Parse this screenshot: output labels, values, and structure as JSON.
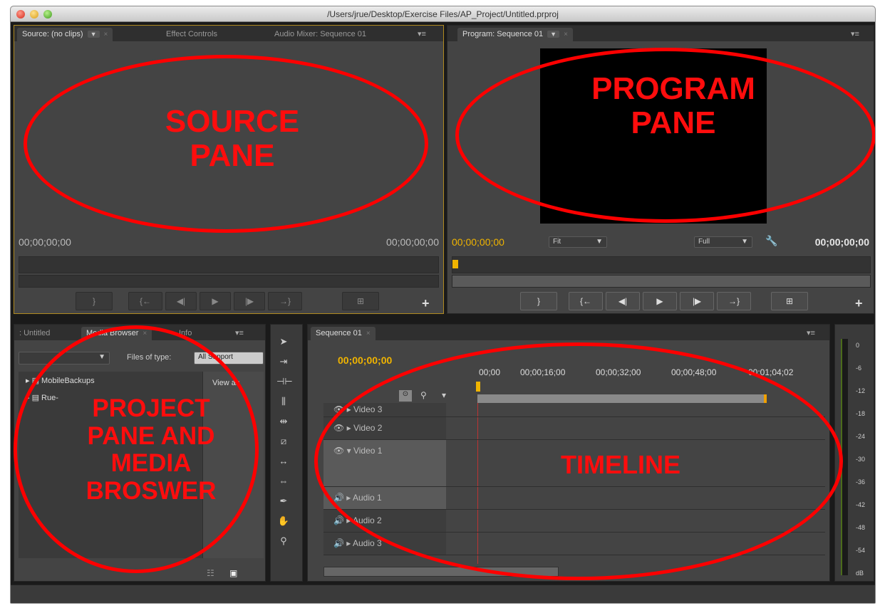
{
  "window": {
    "title": "/Users/jrue/Desktop/Exercise Files/AP_Project/Untitled.prproj"
  },
  "source_panel": {
    "tabs": [
      "Source: (no clips)",
      "Effect Controls",
      "Audio Mixer: Sequence 01"
    ],
    "timecode_left": "00;00;00;00",
    "timecode_right": "00;00;00;00",
    "annotation": "SOURCE PANE"
  },
  "program_panel": {
    "tab": "Program: Sequence 01",
    "timecode_left": "00;00;00;00",
    "timecode_right": "00;00;00;00",
    "fit": "Fit",
    "quality": "Full",
    "annotation": "PROGRAM PANE"
  },
  "project_panel": {
    "tabs": [
      ": Untitled",
      "Media Browser",
      "Info"
    ],
    "files_of_type_label": "Files of type:",
    "files_of_type_value": "All Support",
    "view_as": "View as",
    "items": [
      "MobileBackups",
      "Rue-"
    ],
    "annotation": "PROJECT PANE AND MEDIA BROSWER"
  },
  "timeline": {
    "tab": "Sequence 01",
    "timecode": "00;00;00;00",
    "ruler": [
      "00;00",
      "00;00;16;00",
      "00;00;32;00",
      "00;00;48;00",
      "00;01;04;02"
    ],
    "tracks": [
      "Video 3",
      "Video 2",
      "Video 1",
      "Audio 1",
      "Audio 2",
      "Audio 3"
    ],
    "annotation": "TIMELINE"
  },
  "meter": {
    "labels": [
      "0",
      "-6",
      "-12",
      "-18",
      "-24",
      "-30",
      "-36",
      "-42",
      "-48",
      "-54",
      "dB"
    ]
  },
  "icons": {
    "tools": [
      "selection-tool-icon",
      "track-select-tool-icon",
      "ripple-edit-tool-icon",
      "rolling-edit-tool-icon",
      "rate-stretch-tool-icon",
      "razor-tool-icon",
      "slip-tool-icon",
      "slide-tool-icon",
      "pen-tool-icon",
      "hand-tool-icon",
      "zoom-tool-icon"
    ]
  },
  "colors": {
    "annotation_red": "#ff0000",
    "timecode_yellow": "#f0b400",
    "panel_bg": "#444444"
  }
}
